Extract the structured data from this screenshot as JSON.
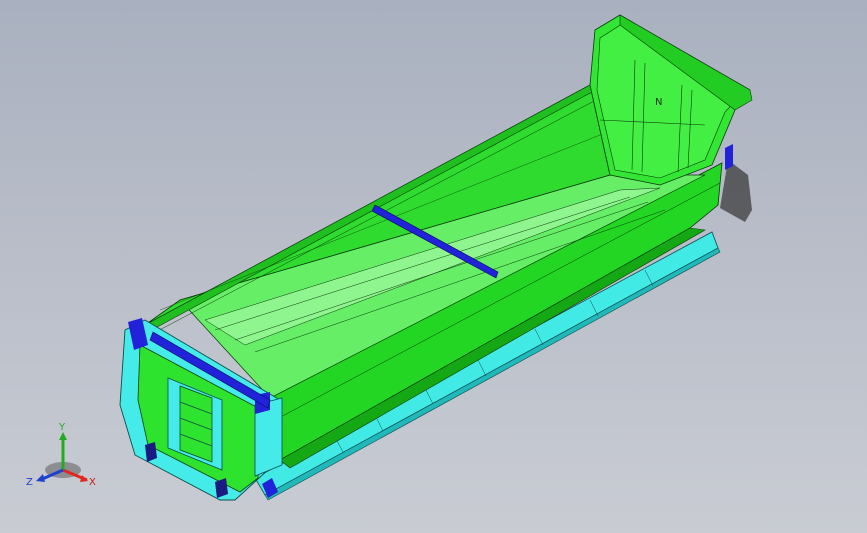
{
  "triad": {
    "x_label": "X",
    "y_label": "Y",
    "z_label": "Z"
  },
  "colors": {
    "viewport_top": "#a9b0bf",
    "viewport_bottom": "#c9ccd3",
    "body_green": "#2ee32e",
    "body_green_light": "#7df27d",
    "body_green_dark": "#19b319",
    "cyan_face": "#44ebe8",
    "cyan_dark": "#1fc0c0",
    "beam_blue": "#2222d9",
    "edge": "#0a3a0a",
    "axis_x": "#e0281e",
    "axis_y": "#22aa22",
    "axis_z": "#2040d0"
  }
}
